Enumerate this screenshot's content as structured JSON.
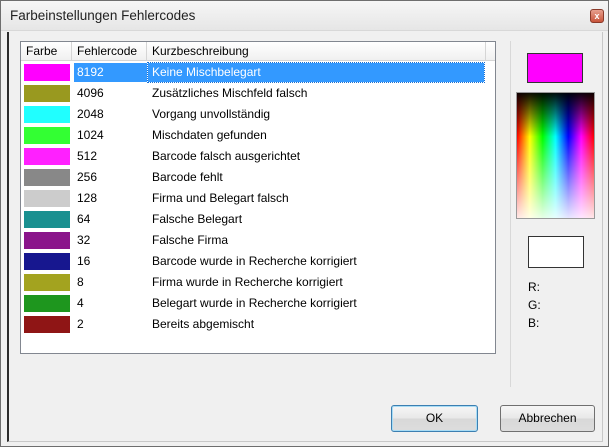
{
  "window": {
    "title": "Farbeinstellungen Fehlercodes",
    "close_glyph": "x"
  },
  "list": {
    "columns": [
      "Farbe",
      "Fehlercode",
      "Kurzbeschreibung"
    ],
    "rows": [
      {
        "color": "#ff00ff",
        "code": "8192",
        "desc": "Keine Mischbelegart",
        "selected": true
      },
      {
        "color": "#99991f",
        "code": "4096",
        "desc": "Zusätzliches Mischfeld falsch"
      },
      {
        "color": "#20ffff",
        "code": "2048",
        "desc": "Vorgang unvollständig"
      },
      {
        "color": "#33ff33",
        "code": "1024",
        "desc": "Mischdaten gefunden"
      },
      {
        "color": "#ff20ff",
        "code": "512",
        "desc": "Barcode falsch ausgerichtet"
      },
      {
        "color": "#888888",
        "code": "256",
        "desc": "Barcode fehlt"
      },
      {
        "color": "#cccccc",
        "code": "128",
        "desc": "Firma und Belegart falsch"
      },
      {
        "color": "#1a9090",
        "code": "64",
        "desc": "Falsche Belegart"
      },
      {
        "color": "#8a158a",
        "code": "32",
        "desc": "Falsche Firma"
      },
      {
        "color": "#17178f",
        "code": "16",
        "desc": "Barcode wurde in Recherche korrigiert"
      },
      {
        "color": "#a3a31f",
        "code": "8",
        "desc": "Firma wurde in Recherche korrigiert"
      },
      {
        "color": "#1e961e",
        "code": "4",
        "desc": "Belegart wurde in Recherche korrigiert"
      },
      {
        "color": "#8f1515",
        "code": "2",
        "desc": "Bereits abgemischt"
      }
    ]
  },
  "picker": {
    "current_color": "#ff00ff",
    "selected_color": "#ffffff",
    "r_label": "R:",
    "g_label": "G:",
    "b_label": "B:"
  },
  "buttons": {
    "ok": "OK",
    "cancel": "Abbrechen"
  }
}
